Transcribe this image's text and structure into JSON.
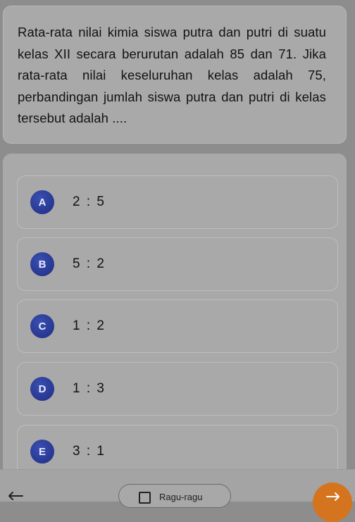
{
  "question": {
    "text": "Rata-rata nilai kimia siswa putra dan putri di suatu kelas XII secara berurutan adalah 85 dan 71. Jika rata-rata nilai keseluruhan kelas adalah 75, perbandingan jumlah siswa putra dan putri di kelas tersebut adalah ...."
  },
  "options": [
    {
      "letter": "A",
      "text": "2 : 5"
    },
    {
      "letter": "B",
      "text": "5 : 2"
    },
    {
      "letter": "C",
      "text": "1 : 2"
    },
    {
      "letter": "D",
      "text": "1 : 3"
    },
    {
      "letter": "E",
      "text": "3 : 1"
    }
  ],
  "footer": {
    "ragu_label": "Ragu-ragu",
    "back_icon": "arrow-left-icon",
    "next_icon": "arrow-right-icon"
  },
  "colors": {
    "badge": "#2a3a9a",
    "next_button": "#d5741f"
  }
}
